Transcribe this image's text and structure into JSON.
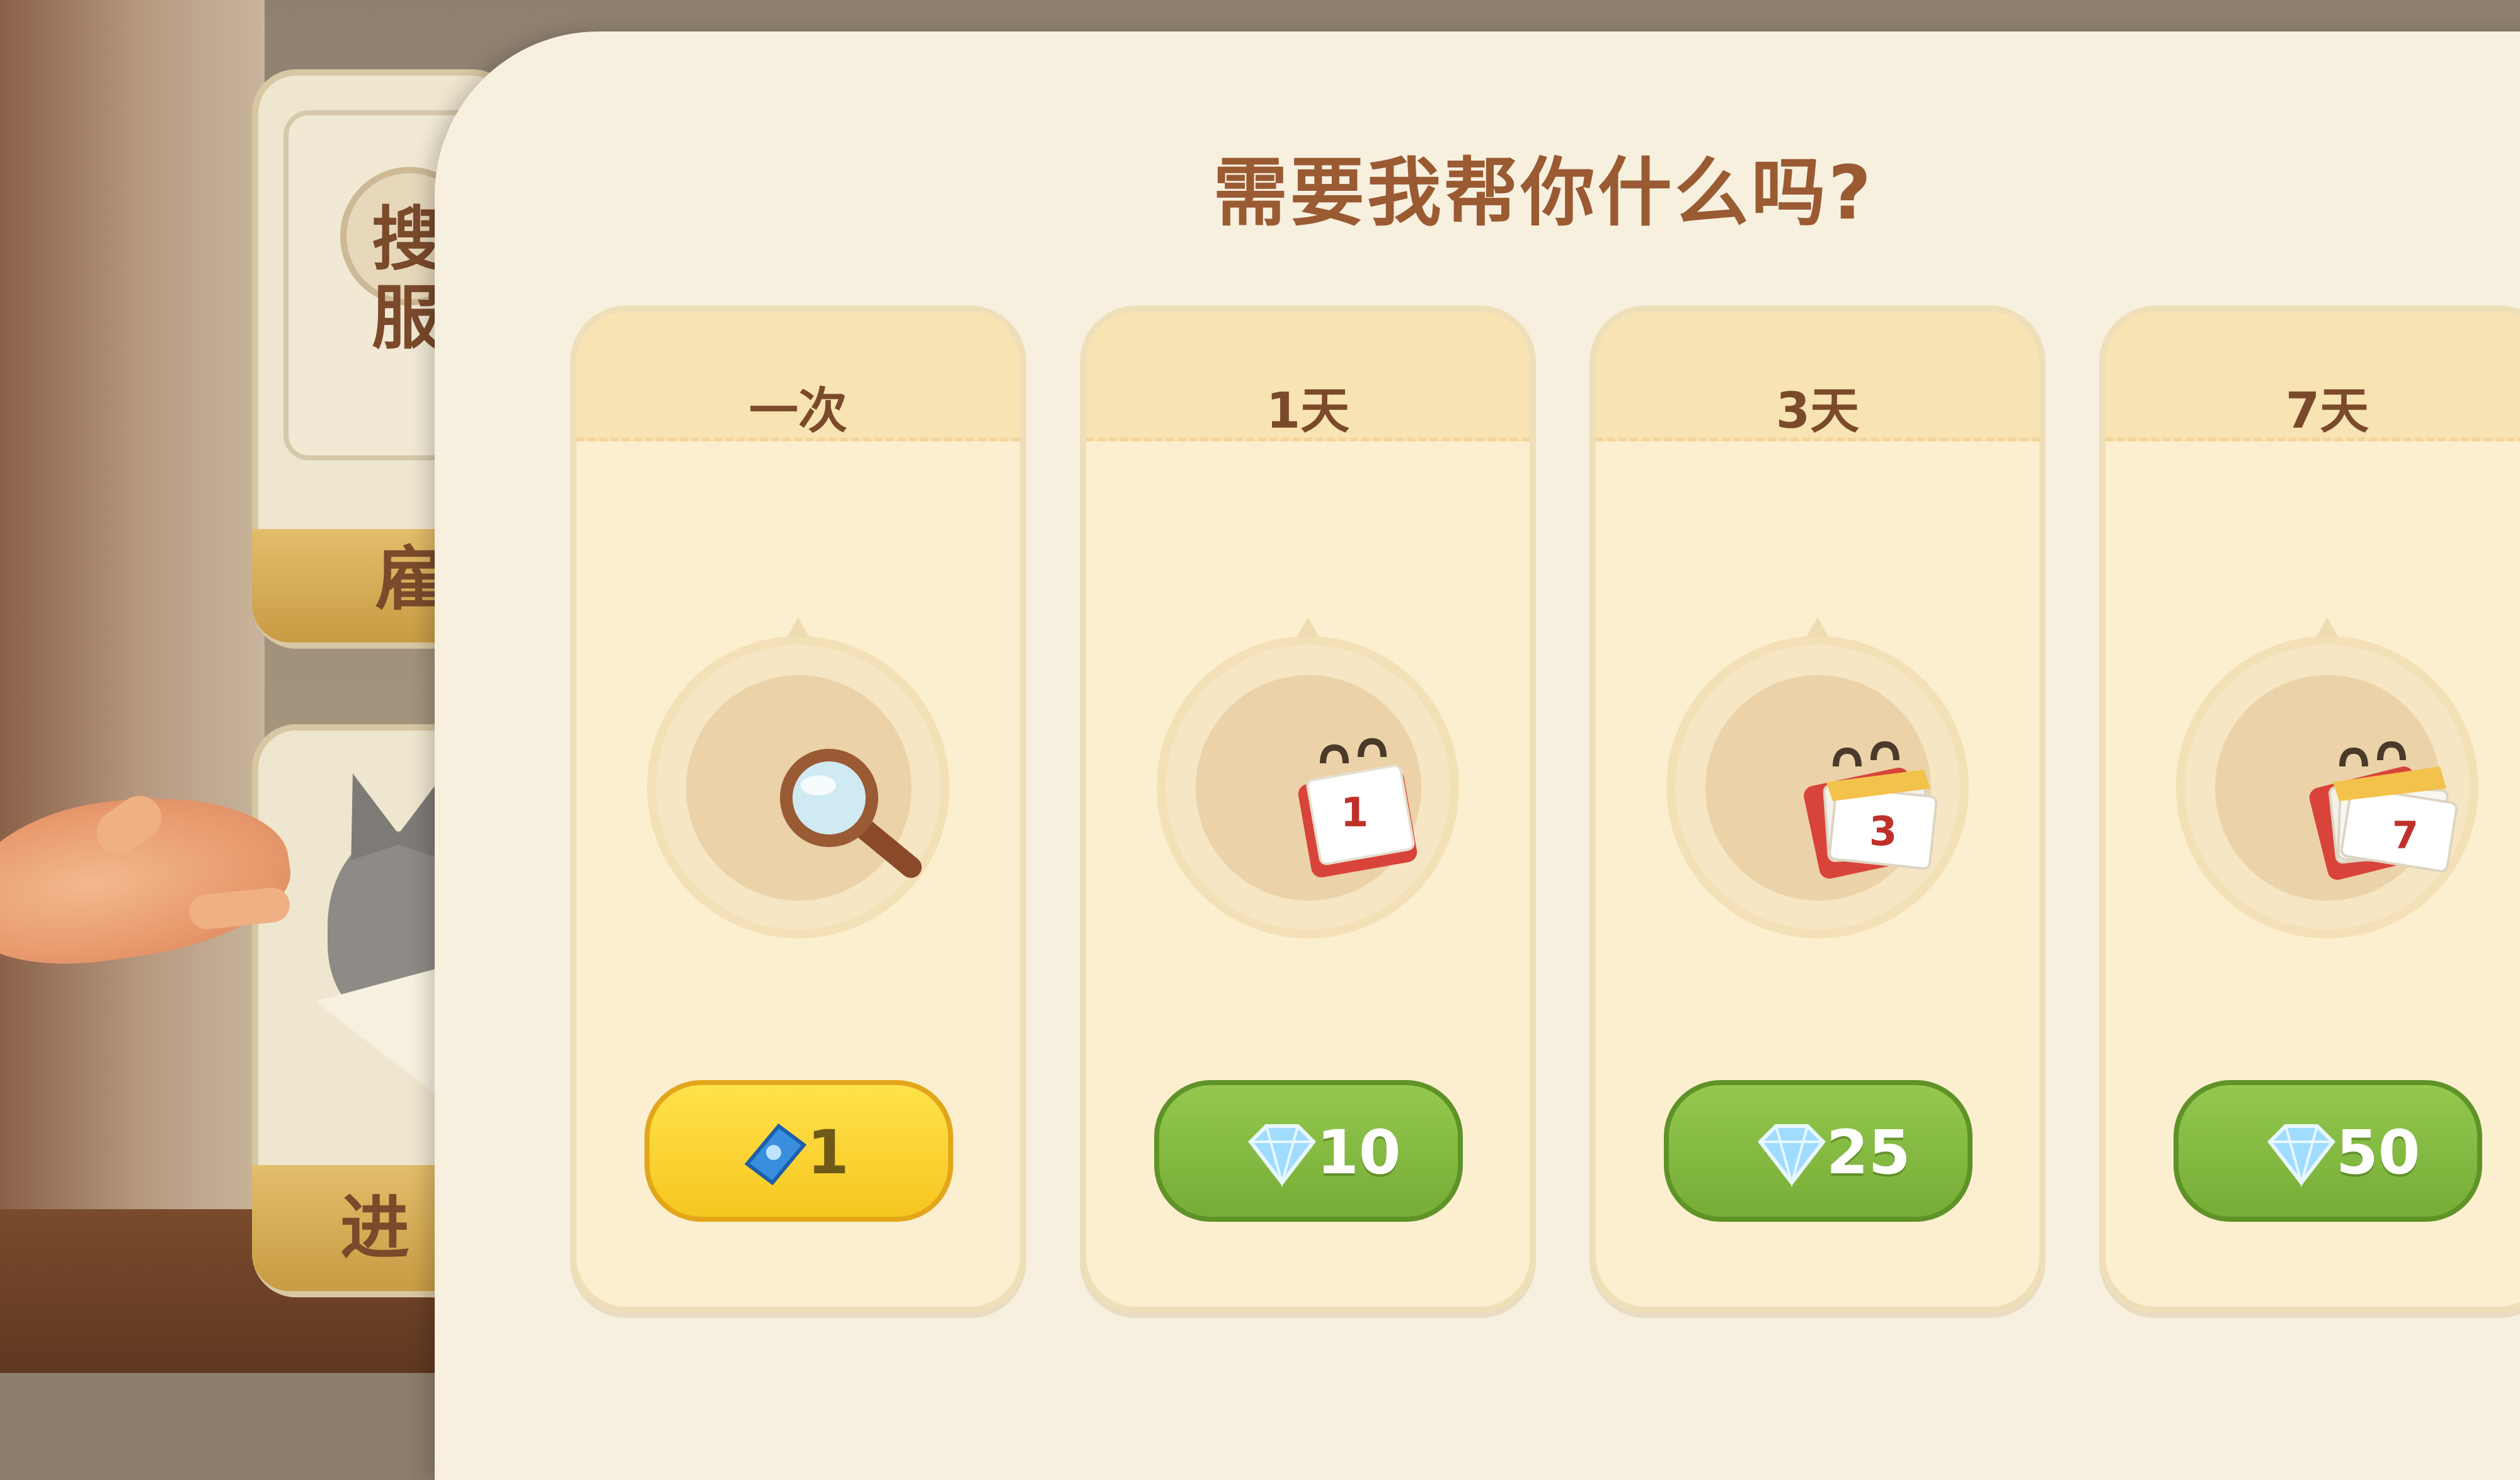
{
  "dialog": {
    "title": "需要我帮你什么吗?"
  },
  "background": {
    "board1_chars": [
      "搜",
      "服",
      "雇"
    ],
    "board2_chars": [
      "进"
    ]
  },
  "cards": [
    {
      "label": "一次",
      "icon": "magnifying-glass-icon",
      "price": "1",
      "currency_icon": "ticket-icon",
      "button_color": "#f6c61f"
    },
    {
      "label": "1天",
      "icon": "calendar-1-icon",
      "price": "10",
      "currency_icon": "diamond-icon",
      "button_color": "#76ad36"
    },
    {
      "label": "3天",
      "icon": "calendar-3-icon",
      "price": "25",
      "currency_icon": "diamond-icon",
      "button_color": "#76ad36"
    },
    {
      "label": "7天",
      "icon": "calendar-7-icon",
      "price": "50",
      "currency_icon": "diamond-icon",
      "button_color": "#76ad36"
    }
  ],
  "calendar_numbers": [
    "1",
    "3",
    "7"
  ]
}
